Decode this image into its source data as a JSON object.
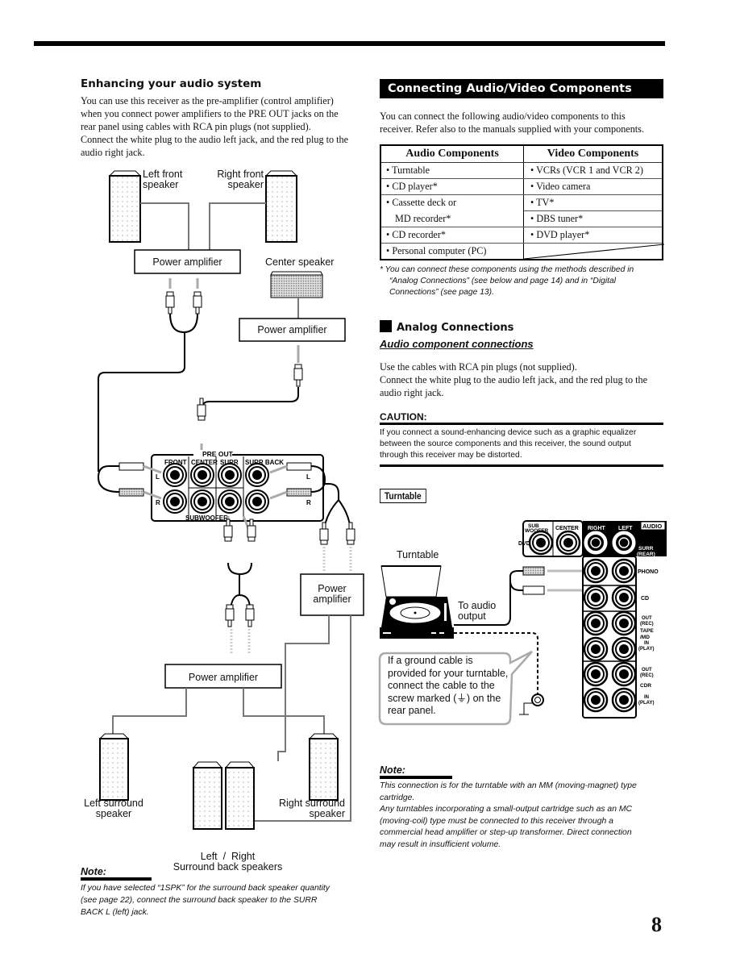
{
  "page_number": "8",
  "left": {
    "heading": "Enhancing your audio system",
    "paragraph_lines": [
      "You can use this receiver as the pre-amplifier (control amplifier)",
      "when you connect power amplifiers to the PRE OUT jacks on the",
      "rear panel using cables with RCA pin plugs (not supplied).",
      "Connect the white plug to the audio left jack, and the red plug to the",
      "audio right jack."
    ],
    "diagram": {
      "left_front_speaker": [
        "Left front",
        "speaker"
      ],
      "right_front_speaker": [
        "Right front",
        "speaker"
      ],
      "front_power_amplifier": "Power amplifier",
      "center_speaker": "Center speaker",
      "center_power_amplifier": "Power amplifier",
      "surr_back_power_amplifier": [
        "Power",
        "amplifier"
      ],
      "surround_power_amplifier": "Power amplifier",
      "left_surround_speaker": [
        "Left surround",
        "speaker"
      ],
      "right_surround_speaker": [
        "Right surround",
        "speaker"
      ],
      "surround_back_speakers": [
        "Left  /  Right",
        "Surround back speakers"
      ],
      "panel": {
        "title": "PRE OUT",
        "columns": [
          "FRONT",
          "CENTER",
          "SURR",
          "SURR BACK"
        ],
        "row_labels": [
          "L",
          "R"
        ],
        "subwoofer": "SUBWOOFER"
      }
    },
    "note": {
      "title": "Note:",
      "lines": [
        "If you have selected  “1SPK” for the surround back speaker quantity",
        "(see page 22), connect the surround back speaker to the SURR",
        "BACK L (left) jack."
      ]
    }
  },
  "right": {
    "banner": "Connecting Audio/Video Components",
    "intro_lines": [
      "You can connect the following audio/video components to this",
      "receiver. Refer also to the manuals supplied with your components."
    ],
    "table": {
      "headers": [
        "Audio Components",
        "Video Components"
      ],
      "audio": [
        "• Turntable",
        "• CD player*",
        "• Cassette deck or",
        "MD recorder*",
        "• CD recorder*",
        "• Personal computer (PC)"
      ],
      "video": [
        "• VCRs (VCR 1 and VCR 2)",
        "• Video camera",
        "• TV*",
        "• DBS tuner*",
        "• DVD player*",
        ""
      ]
    },
    "footnote_lines": [
      "*  You can connect these components using the methods described in",
      "“Analog Connections” (see below and page 14) and in “Digital",
      "Connections” (see page 13)."
    ],
    "analog": {
      "heading": "Analog Connections",
      "subheading": "Audio component connections",
      "lines": [
        "Use the cables with RCA pin plugs (not supplied).",
        "Connect the white plug to the audio left jack, and the red plug to the",
        "audio right jack."
      ]
    },
    "caution": {
      "title": "CAUTION:",
      "lines": [
        "If you connect a sound-enhancing device such as a graphic equalizer",
        "between the source components and this receiver, the sound output",
        "through this receiver may be distorted."
      ]
    },
    "turntable_tag": "Turntable",
    "turntable_diagram": {
      "turntable_label": "Turntable",
      "to_audio_output": [
        "To audio",
        "output"
      ],
      "callout_lines": [
        "If a ground cable is",
        "provided for your turntable,",
        "connect the cable to the",
        "screw marked (⏚) on the",
        "rear panel."
      ],
      "panel": {
        "top_labels": [
          "SUB WOOFER",
          "CENTER",
          "RIGHT",
          "LEFT"
        ],
        "audio_tag": "AUDIO",
        "dvd": "DVD",
        "surr_rear": [
          "SURR",
          "(REAR)"
        ],
        "phono": "PHONO",
        "cd": "CD",
        "tape": [
          "OUT",
          "(REC)",
          "TAPE",
          "/MD",
          "IN",
          "(PLAY)"
        ],
        "cdr": [
          "OUT",
          "(REC)",
          "CDR",
          "IN",
          "(PLAY)"
        ]
      }
    },
    "note": {
      "title": "Note:",
      "lines": [
        "This connection is for the turntable with an MM (moving-magnet) type",
        "cartridge.",
        "Any turntables incorporating a small-output cartridge such as an MC",
        "(moving-coil) type must be connected to this receiver through a",
        "commercial head amplifier or step-up transformer. Direct connection",
        "may result in insufficient volume."
      ]
    }
  }
}
